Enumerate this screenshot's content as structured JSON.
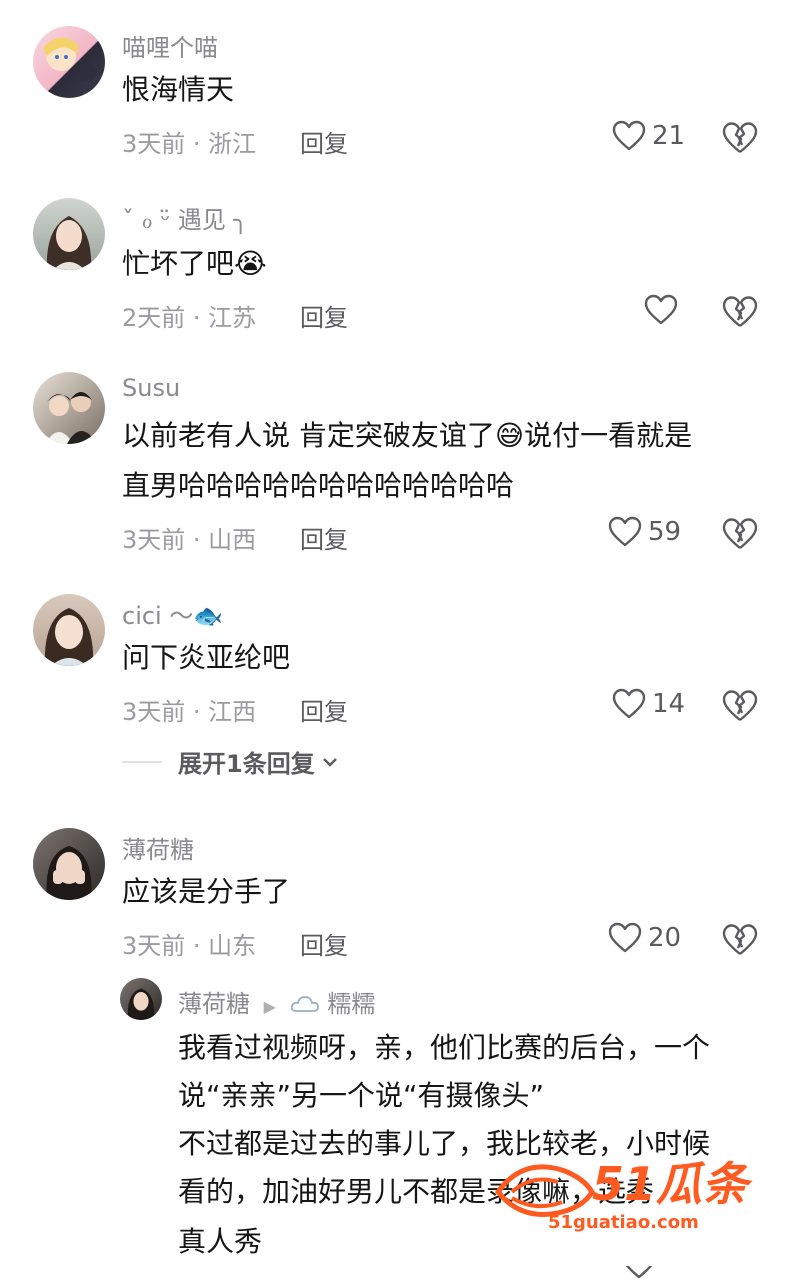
{
  "comments": [
    {
      "user": "喵哩个喵",
      "text": "恨海情天",
      "time": "3天前 · 浙江",
      "reply": "回复",
      "likes": "21"
    },
    {
      "user": "ˇ ℴ ᵕ̈ 遇见 ╮",
      "text": "忙坏了吧",
      "emoji": "😭",
      "time": "2天前 · 江苏",
      "reply": "回复",
      "likes": ""
    },
    {
      "user": "Susu",
      "text_line1": "以前老有人说 肯定突破友谊了",
      "emoji": "😅",
      "text_line1b": "说付一看就是",
      "text_line2": "直男哈哈哈哈哈哈哈哈哈哈哈哈",
      "time": "3天前 · 山西",
      "reply": "回复",
      "likes": "59"
    },
    {
      "user": "cici ～",
      "emoji": "🐟",
      "text": "问下炎亚纶吧",
      "time": "3天前 · 江西",
      "reply": "回复",
      "likes": "14",
      "expand": "展开1条回复"
    },
    {
      "user": "薄荷糖",
      "text": "应该是分手了",
      "time": "3天前 · 山东",
      "reply": "回复",
      "likes": "20"
    }
  ],
  "nested_reply": {
    "user": "薄荷糖",
    "arrow": "▶",
    "reply_to": "糯糯",
    "lines": [
      "我看过视频呀，亲，他们比赛的后台，一个",
      "说“亲亲”另一个说“有摄像头”",
      "不过都是过去的事儿了，我比较老，小时候",
      "看的，加油好男儿不都是",
      "真人秀"
    ],
    "line4_tail": "录像嘛，选秀"
  },
  "watermark": {
    "big": "51瓜条",
    "small": "51guatiao.com",
    "color": "#ff5a1f"
  }
}
